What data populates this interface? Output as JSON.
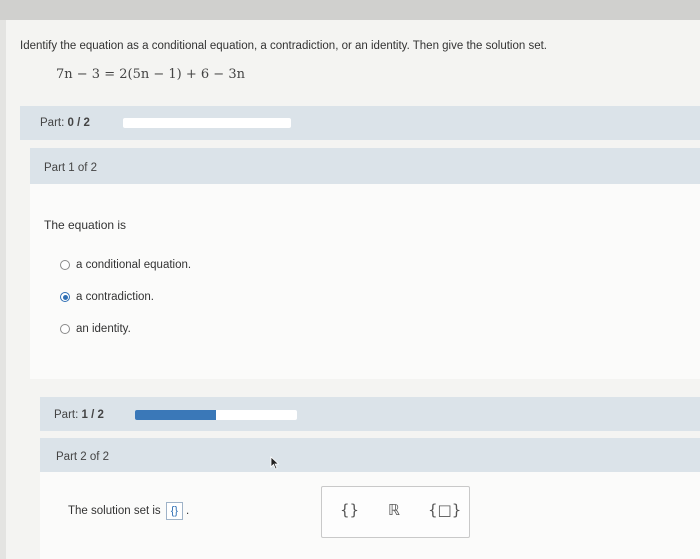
{
  "problem": {
    "prompt": "Identify the equation as a conditional equation, a contradiction, or an identity. Then give the solution set.",
    "equation": {
      "lhs": "7n − 3",
      "rhs": "2(5n − 1) + 6 − 3n"
    }
  },
  "progress_top": {
    "label_prefix": "Part: ",
    "value": "0 / 2",
    "fraction": 0
  },
  "part1": {
    "title": "Part 1 of 2",
    "question": "The equation is",
    "options": [
      {
        "label": "a conditional equation.",
        "selected": false
      },
      {
        "label": "a contradiction.",
        "selected": true
      },
      {
        "label": "an identity.",
        "selected": false
      }
    ]
  },
  "progress_mid": {
    "label_prefix": "Part: ",
    "value": "1 / 2",
    "fraction": 0.5
  },
  "part2": {
    "title": "Part 2 of 2",
    "answer_label": "The solution set is",
    "answer_value": "{}",
    "answer_suffix": "."
  },
  "palette": {
    "empty_set_label": "{}",
    "reals_label": "ℝ",
    "set_builder_label": "{□}"
  },
  "colors": {
    "accent": "#3a78b8",
    "band": "#dbe3e9"
  }
}
